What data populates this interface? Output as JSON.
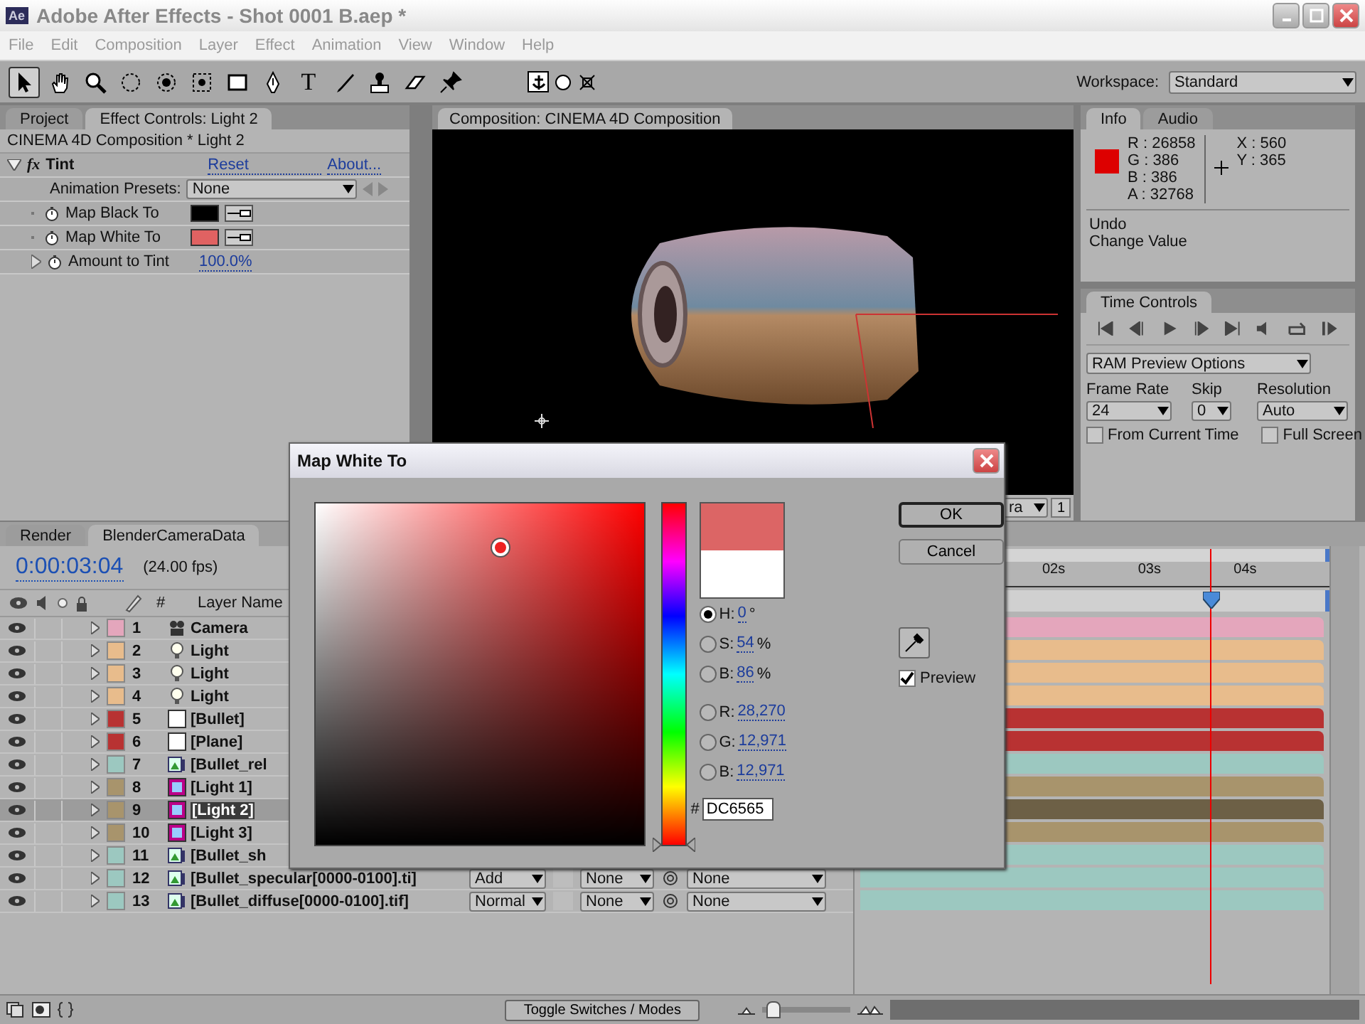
{
  "window": {
    "logo": "Ae",
    "title": "Adobe After Effects - Shot 0001 B.aep *"
  },
  "menu": [
    "File",
    "Edit",
    "Composition",
    "Layer",
    "Effect",
    "Animation",
    "View",
    "Window",
    "Help"
  ],
  "tools": [
    {
      "kind": "select",
      "selected": true
    },
    {
      "kind": "hand",
      "selected": false
    },
    {
      "kind": "zoom",
      "selected": false
    },
    {
      "kind": "rotate",
      "selected": false
    },
    {
      "kind": "orbit",
      "selected": false
    },
    {
      "kind": "track",
      "selected": false
    },
    {
      "kind": "rect",
      "selected": false
    },
    {
      "kind": "pen",
      "selected": false
    },
    {
      "kind": "text",
      "glyph": "T",
      "selected": false
    },
    {
      "kind": "brush",
      "selected": false
    },
    {
      "kind": "stamp",
      "selected": false
    },
    {
      "kind": "eraser",
      "selected": false
    },
    {
      "kind": "pin",
      "selected": false
    }
  ],
  "axis_modes": [
    {
      "kind": "local",
      "selected": true
    },
    {
      "kind": "world",
      "selected": false
    },
    {
      "kind": "view",
      "selected": false
    }
  ],
  "workspace": {
    "label": "Workspace:",
    "value": "Standard"
  },
  "effect_panel": {
    "tabs": [
      {
        "label": "Project",
        "selected": false
      },
      {
        "label": "Effect Controls: Light 2",
        "selected": true
      }
    ],
    "layer_path": "CINEMA 4D Composition * Light 2",
    "effect": {
      "icon": "fx",
      "name": "Tint",
      "reset": "Reset",
      "about": "About..."
    },
    "presets": {
      "label": "Animation Presets:",
      "value": "None"
    },
    "params": [
      {
        "kind": "color",
        "name": "Map Black To",
        "color": "#000000"
      },
      {
        "kind": "color",
        "name": "Map White To",
        "color": "#e06262"
      },
      {
        "kind": "value",
        "name": "Amount to Tint",
        "value": "100.0%"
      }
    ]
  },
  "composition": {
    "tab": "Composition: CINEMA 4D Composition",
    "camera_menu": "ra",
    "view_count": "1"
  },
  "info": {
    "tabs": [
      {
        "label": "Info",
        "selected": true
      },
      {
        "label": "Audio",
        "selected": false
      }
    ],
    "channels": [
      "R : 26858",
      "G : 386",
      "B : 386",
      "A : 32768"
    ],
    "coords": [
      "X : 560",
      "Y : 365"
    ],
    "history": [
      "Undo",
      "Change Value"
    ]
  },
  "time_controls": {
    "title": "Time Controls",
    "preview": "RAM Preview Options",
    "fields": [
      {
        "label": "Frame Rate",
        "value": "24"
      },
      {
        "label": "Skip",
        "value": "0"
      },
      {
        "label": "Resolution",
        "value": "Auto"
      }
    ],
    "options": [
      {
        "label": "From Current Time",
        "checked": false
      },
      {
        "label": "Full Screen",
        "checked": false
      }
    ]
  },
  "timeline": {
    "tabs": [
      {
        "label": "Render",
        "selected": false
      },
      {
        "label": "BlenderCameraData",
        "selected": true
      }
    ],
    "timecode": "0:00:03:04",
    "fps": "(24.00 fps)",
    "columns": {
      "number": "#",
      "name": "Layer Name"
    },
    "ruler": [
      "02s",
      "03s",
      "04s"
    ],
    "layers": [
      {
        "number": "1",
        "name": "Camera",
        "kind": "camera",
        "color": "#e4a6bc",
        "visible": true,
        "selected": false
      },
      {
        "number": "2",
        "name": "Light",
        "kind": "light",
        "color": "#e8bc8c",
        "visible": true,
        "selected": false
      },
      {
        "number": "3",
        "name": "Light",
        "kind": "light",
        "color": "#e8bc8c",
        "visible": true,
        "selected": false
      },
      {
        "number": "4",
        "name": "Light",
        "kind": "light",
        "color": "#e8bc8c",
        "visible": true,
        "selected": false
      },
      {
        "number": "5",
        "name": "[Bullet]",
        "kind": "solid",
        "color": "#b83232",
        "visible": true,
        "selected": false
      },
      {
        "number": "6",
        "name": "[Plane]",
        "kind": "solid",
        "color": "#b83232",
        "visible": true,
        "selected": false
      },
      {
        "number": "7",
        "name": "[Bullet_rel",
        "kind": "footage",
        "color": "#9cc8c0",
        "visible": true,
        "selected": false
      },
      {
        "number": "8",
        "name": "[Light 1]",
        "kind": "composition",
        "color": "#a8946c",
        "visible": true,
        "selected": false
      },
      {
        "number": "9",
        "name": "[Light 2]",
        "kind": "composition",
        "color": "#a8946c",
        "visible": true,
        "selected": true
      },
      {
        "number": "10",
        "name": "[Light 3]",
        "kind": "composition",
        "color": "#a8946c",
        "visible": true,
        "selected": false
      },
      {
        "number": "11",
        "name": "[Bullet_sh",
        "kind": "footage",
        "color": "#9cc8c0",
        "visible": true,
        "selected": false
      },
      {
        "number": "12",
        "name": "[Bullet_specular[0000-0100].ti]",
        "kind": "footage",
        "color": "#9cc8c0",
        "visible": true,
        "selected": false,
        "mode": "Add",
        "track_matte": "None",
        "parent": "None"
      },
      {
        "number": "13",
        "name": "[Bullet_diffuse[0000-0100].tif]",
        "kind": "footage",
        "color": "#9cc8c0",
        "visible": true,
        "selected": false,
        "mode": "Normal",
        "track_matte": "None",
        "parent": "None"
      }
    ],
    "toggle": "Toggle Switches / Modes",
    "zoom": {
      "level": 0.05
    }
  },
  "dialog": {
    "title": "Map White To",
    "fields": [
      {
        "label": "H:",
        "value": "0",
        "unit": "°",
        "selected": true
      },
      {
        "label": "S:",
        "value": "54",
        "unit": "%",
        "selected": false
      },
      {
        "label": "B:",
        "value": "86",
        "unit": "%",
        "selected": false
      },
      {
        "label": "R:",
        "value": "28,270",
        "selected": false
      },
      {
        "label": "G:",
        "value": "12,971",
        "selected": false
      },
      {
        "label": "B:",
        "value": "12,971",
        "selected": false
      }
    ],
    "hue": {
      "level": 0
    },
    "hex_label": "#",
    "hex": "DC6565",
    "buttons": [
      "OK",
      "Cancel"
    ],
    "preview": {
      "label": "Preview",
      "checked": true
    }
  }
}
